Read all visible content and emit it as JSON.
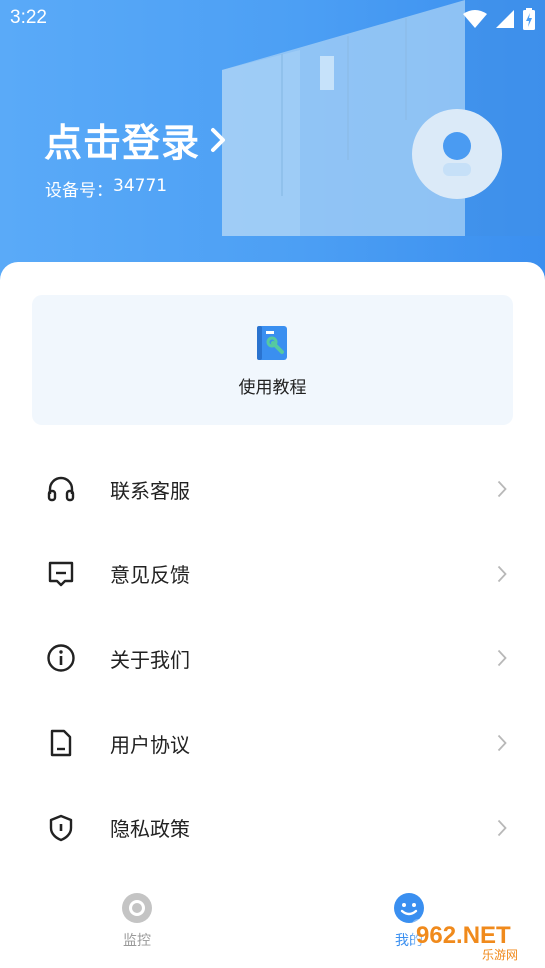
{
  "status_bar": {
    "time": "3:22"
  },
  "header": {
    "login_title": "点击登录",
    "device_label": "设备号：",
    "device_number": "34771"
  },
  "tutorial": {
    "label": "使用教程"
  },
  "menu": {
    "items": [
      {
        "label": "联系客服",
        "icon": "headset-icon"
      },
      {
        "label": "意见反馈",
        "icon": "feedback-icon"
      },
      {
        "label": "关于我们",
        "icon": "info-icon"
      },
      {
        "label": "用户协议",
        "icon": "document-icon"
      },
      {
        "label": "隐私政策",
        "icon": "shield-icon"
      }
    ]
  },
  "tabbar": {
    "tabs": [
      {
        "label": "监控",
        "active": false
      },
      {
        "label": "我的",
        "active": true
      }
    ]
  },
  "watermark": {
    "text": "962.NET",
    "subtext": "乐游网"
  },
  "colors": {
    "accent": "#3a8ff0",
    "header": "#4c9ff4",
    "tutorial_bg": "#f1f7fd"
  }
}
